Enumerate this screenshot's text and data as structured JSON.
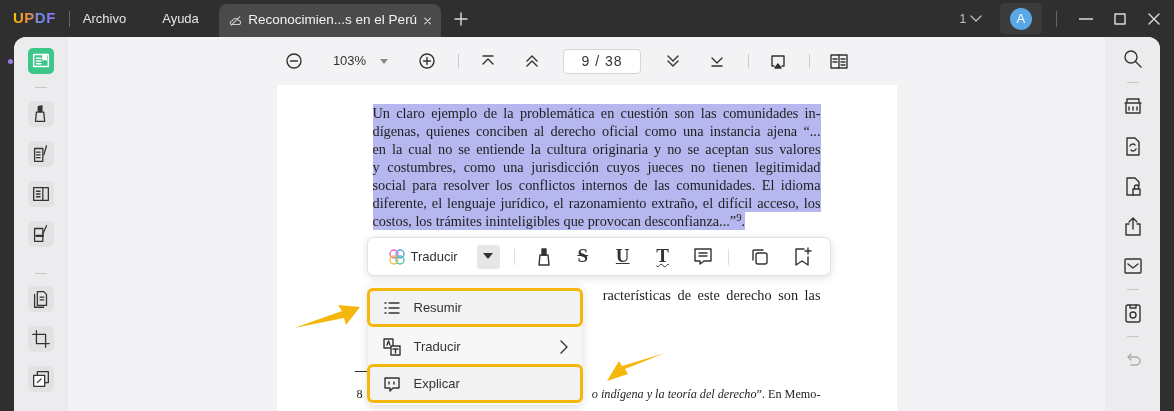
{
  "app": {
    "logo": "UPDF",
    "menus": [
      "Archivo",
      "Ayuda"
    ],
    "tab": {
      "title": "Reconocimien...s en el Perú",
      "selected": true
    },
    "window_count": "1",
    "avatar": "A"
  },
  "left_toolbar": [
    {
      "selected": true
    },
    {
      "selected": false
    },
    {
      "selected": false
    },
    {
      "selected": false
    },
    {
      "selected": false
    },
    {
      "selected": false
    },
    {
      "selected": false
    },
    {
      "selected": false
    }
  ],
  "toolbar": {
    "zoom": "103%",
    "page": "9 / 38"
  },
  "document": {
    "paragraph": {
      "selected": true,
      "lines": [
        "Un claro ejemplo de la problemática en cuestión son las comunidades in-",
        "dígenas, quienes conciben al derecho oficial como una instancia ajena “...",
        "en la cual no se entiende la cultura originaria y no se aceptan sus valores",
        "y costumbres, como una jurisdicción cuyos jueces no tienen legitimidad",
        "social para resolver los conflictos internos de las comunidades. El idioma",
        "diferente, el lenguaje jurídico, el razonamiento extraño, el difícil acceso, los",
        "costos, los trámites ininteligibles que provocan desconfianza...”$^{9}$."
      ]
    },
    "fragment_line": "racterísticas de este derecho son las",
    "footnote": {
      "number": "8",
      "text": "*o indígena y la teoría del derecho*”. En Memo-"
    }
  },
  "popup": {
    "ai_label": "Traducir",
    "format_buttons": [
      {
        "glyph": "S",
        "kind": "strike"
      },
      {
        "glyph": "U",
        "kind": "underline"
      },
      {
        "glyph": "T",
        "kind": "wavy"
      }
    ]
  },
  "menu": [
    {
      "label": "Resumir",
      "kind": "list",
      "highlighted": true
    },
    {
      "label": "Traducir",
      "kind": "translate",
      "highlighted": false
    },
    {
      "label": "Explicar",
      "kind": "explain",
      "highlighted": true
    }
  ]
}
